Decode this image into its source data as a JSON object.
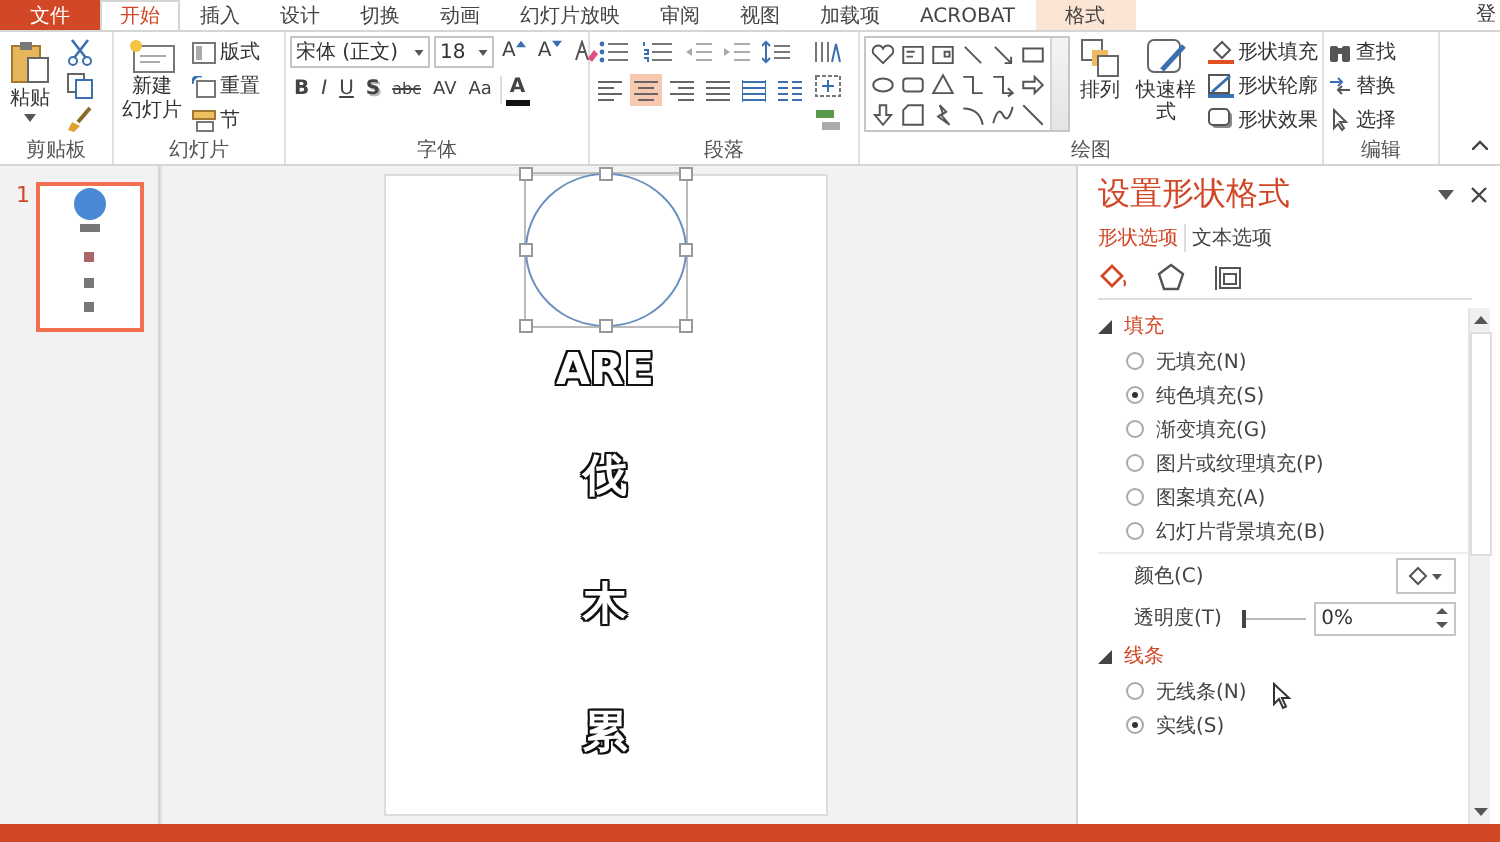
{
  "tabs": [
    {
      "label": "文件",
      "kind": "file",
      "selected": false
    },
    {
      "label": "开始",
      "kind": "normal",
      "selected": true
    },
    {
      "label": "插入",
      "kind": "normal",
      "selected": false
    },
    {
      "label": "设计",
      "kind": "normal",
      "selected": false
    },
    {
      "label": "切换",
      "kind": "normal",
      "selected": false
    },
    {
      "label": "动画",
      "kind": "normal",
      "selected": false
    },
    {
      "label": "幻灯片放映",
      "kind": "normal",
      "selected": false
    },
    {
      "label": "审阅",
      "kind": "normal",
      "selected": false
    },
    {
      "label": "视图",
      "kind": "normal",
      "selected": false
    },
    {
      "label": "加载项",
      "kind": "normal",
      "selected": false
    },
    {
      "label": "ACROBAT",
      "kind": "normal",
      "selected": false
    },
    {
      "label": "格式",
      "kind": "contextual",
      "selected": false
    }
  ],
  "account": "登",
  "ribbon": {
    "clipboard": {
      "label": "剪贴板",
      "paste": "粘贴"
    },
    "slides": {
      "label": "幻灯片",
      "new_slide": [
        "新建",
        "幻灯片"
      ],
      "commands": [
        {
          "label": "版式",
          "kind": "layout"
        },
        {
          "label": "重置",
          "kind": "reset"
        },
        {
          "label": "节",
          "kind": "section"
        }
      ]
    },
    "font": {
      "label": "字体",
      "font_name": "宋体 (正文)",
      "font_size": "18",
      "grow": "A",
      "shrink": "A",
      "styles": [
        {
          "text": "B",
          "kind": "bold"
        },
        {
          "text": "I",
          "kind": "italic"
        },
        {
          "text": "U",
          "kind": "underline"
        },
        {
          "text": "S",
          "kind": "shadow"
        },
        {
          "text": "abc",
          "kind": "strike"
        },
        {
          "text": "AV",
          "kind": "spacing"
        },
        {
          "text": "Aa",
          "kind": "case"
        }
      ],
      "font_color": "A"
    },
    "paragraph": {
      "label": "段落",
      "alignments": [
        {
          "kind": "left",
          "selected": false
        },
        {
          "kind": "center",
          "selected": true
        },
        {
          "kind": "right",
          "selected": false
        },
        {
          "kind": "justify",
          "selected": false
        },
        {
          "kind": "distributed",
          "selected": false
        }
      ]
    },
    "drawing": {
      "label": "绘图",
      "arrange": "排列",
      "quick_styles": "快速样式",
      "commands": [
        {
          "label": "形状填充",
          "kind": "fill"
        },
        {
          "label": "形状轮廓",
          "kind": "outline"
        },
        {
          "label": "形状效果",
          "kind": "effects"
        }
      ]
    },
    "editing": {
      "label": "编辑",
      "commands": [
        {
          "label": "查找",
          "kind": "find"
        },
        {
          "label": "替换",
          "kind": "replace"
        },
        {
          "label": "选择",
          "kind": "select"
        }
      ]
    }
  },
  "thumbnails": [
    {
      "number": "1",
      "selected": true
    }
  ],
  "slide": {
    "texts": [
      "ARE",
      "伐",
      "木",
      "累"
    ]
  },
  "panel": {
    "title": "设置形状格式",
    "tabs": [
      {
        "label": "形状选项",
        "selected": true
      },
      {
        "label": "文本选项",
        "selected": false
      }
    ],
    "icon_tabs": [
      {
        "kind": "fill",
        "selected": true
      },
      {
        "kind": "effects",
        "selected": false
      },
      {
        "kind": "size",
        "selected": false
      }
    ],
    "sections": [
      {
        "title": "填充",
        "expanded": true,
        "options": [
          {
            "label": "无填充(N)",
            "selected": false
          },
          {
            "label": "纯色填充(S)",
            "selected": true
          },
          {
            "label": "渐变填充(G)",
            "selected": false
          },
          {
            "label": "图片或纹理填充(P)",
            "selected": false
          },
          {
            "label": "图案填充(A)",
            "selected": false
          },
          {
            "label": "幻灯片背景填充(B)",
            "selected": false
          }
        ],
        "color_label": "颜色(C)",
        "transparency": {
          "label": "透明度(T)",
          "level": 0,
          "value": "0%"
        }
      },
      {
        "title": "线条",
        "expanded": true,
        "options": [
          {
            "label": "无线条(N)",
            "selected": false
          },
          {
            "label": "实线(S)",
            "selected": true
          }
        ]
      }
    ]
  }
}
